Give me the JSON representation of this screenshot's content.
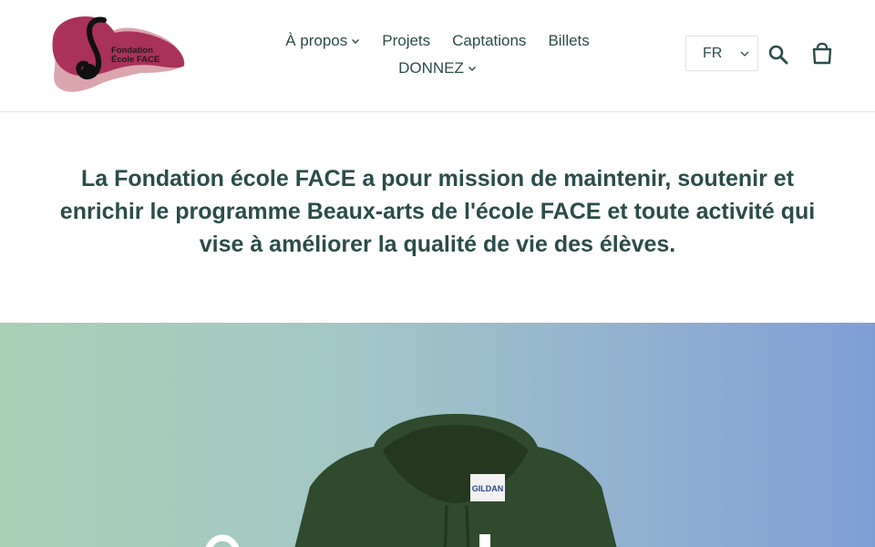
{
  "header": {
    "logo": {
      "line1": "Fondation",
      "line2": "École FACE"
    },
    "nav": {
      "row1": [
        {
          "label": "À propos",
          "has_dropdown": true
        },
        {
          "label": "Projets",
          "has_dropdown": false
        },
        {
          "label": "Captations",
          "has_dropdown": false
        },
        {
          "label": "Billets",
          "has_dropdown": false
        }
      ],
      "row2": [
        {
          "label": "DONNEZ",
          "has_dropdown": true
        }
      ]
    },
    "language": {
      "selected": "FR"
    },
    "icons": {
      "search": "search-icon",
      "cart": "cart-icon"
    }
  },
  "mission": {
    "text": "La Fondation école FACE a pour mission de maintenir, soutenir et enrichir le programme Beaux-arts de l'école FACE et toute activité qui vise à améliorer la qualité de vie des élèves."
  },
  "colors": {
    "text": "#2b4d49",
    "logo_dark": "#a62a55",
    "logo_light": "#dba5ae",
    "hero_left": "#a9cfb4",
    "hero_right": "#7f9ed6",
    "hoodie": "#2f4a2c"
  }
}
